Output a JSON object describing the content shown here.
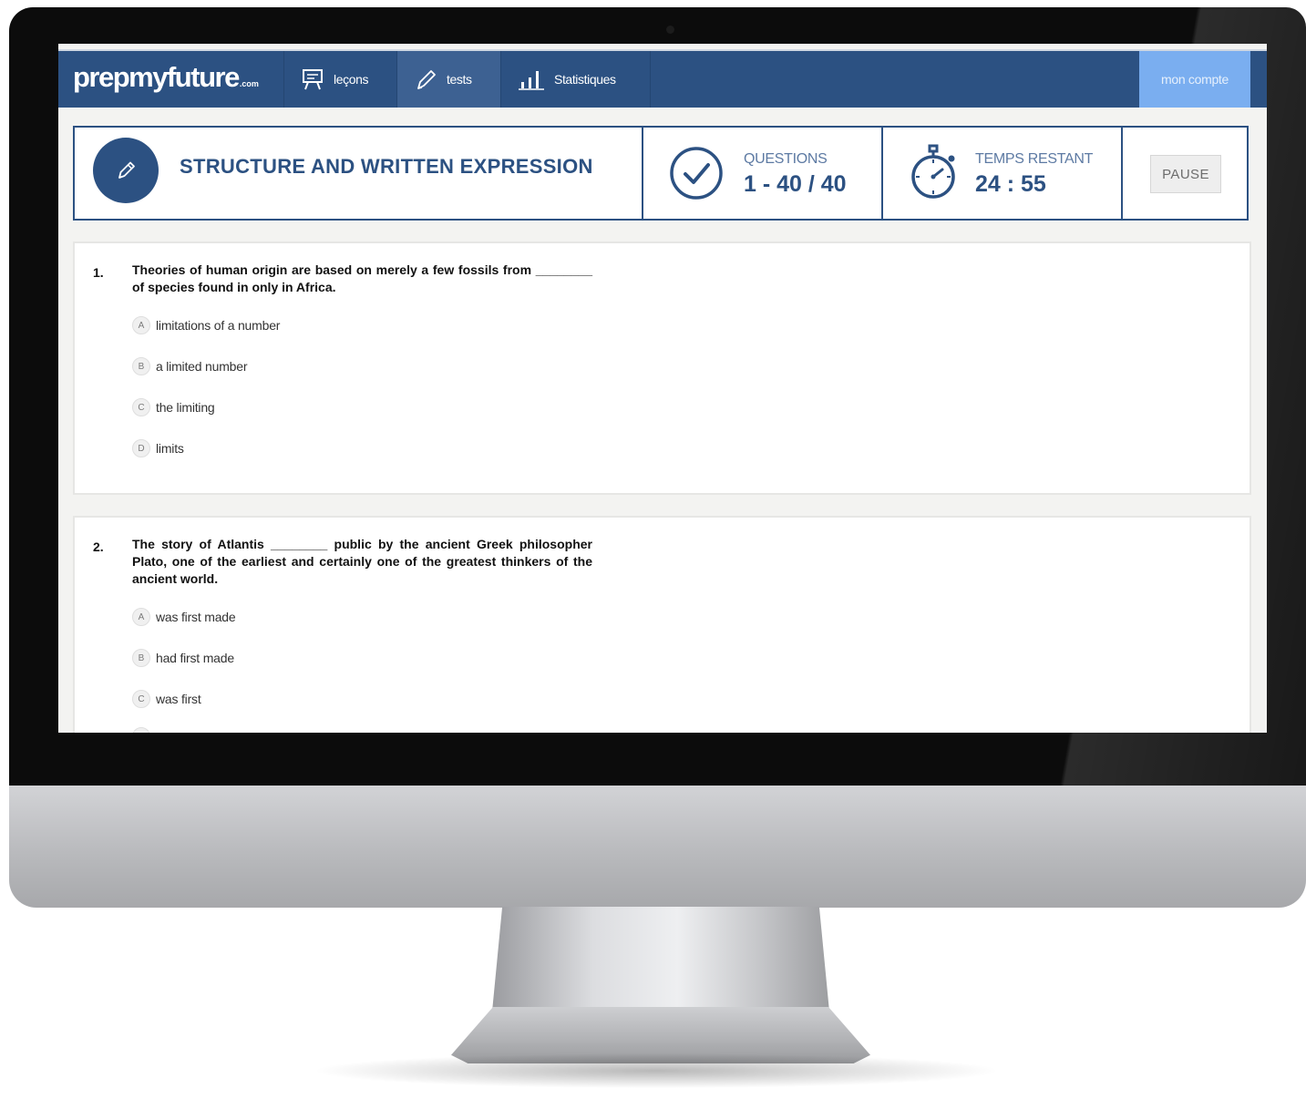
{
  "nav": {
    "logo": "prepmyfuture",
    "logo_suffix": ".com",
    "items": [
      {
        "label": "leçons",
        "icon": "board-icon"
      },
      {
        "label": "tests",
        "icon": "pencil-icon"
      },
      {
        "label": "Statistiques",
        "icon": "bar-chart-icon"
      }
    ],
    "active_item": "tests",
    "account_label": "mon compte"
  },
  "test_header": {
    "section_title": "STRUCTURE AND WRITTEN EXPRESSION",
    "questions_label": "QUESTIONS",
    "questions_value": "1 - 40 / 40",
    "time_label": "TEMPS RESTANT",
    "time_value": "24 : 55",
    "pause_label": "PAUSE"
  },
  "questions": [
    {
      "number": "1.",
      "text": "Theories of human origin are based on merely a few fossils from ________ of species found in only in Africa.",
      "options": [
        {
          "letter": "A",
          "text": "limitations of a number"
        },
        {
          "letter": "B",
          "text": "a limited number"
        },
        {
          "letter": "C",
          "text": "the limiting"
        },
        {
          "letter": "D",
          "text": "limits"
        }
      ]
    },
    {
      "number": "2.",
      "text": "The story of Atlantis ________ public by the ancient Greek philosopher Plato, one of the earliest and certainly one of the greatest thinkers of the ancient world.",
      "options": [
        {
          "letter": "A",
          "text": "was first made"
        },
        {
          "letter": "B",
          "text": "had first made"
        },
        {
          "letter": "C",
          "text": "was first"
        }
      ]
    }
  ],
  "colors": {
    "brand_navy": "#2c5182",
    "nav_active": "#3d6192",
    "account_blue": "#7aaef0"
  }
}
